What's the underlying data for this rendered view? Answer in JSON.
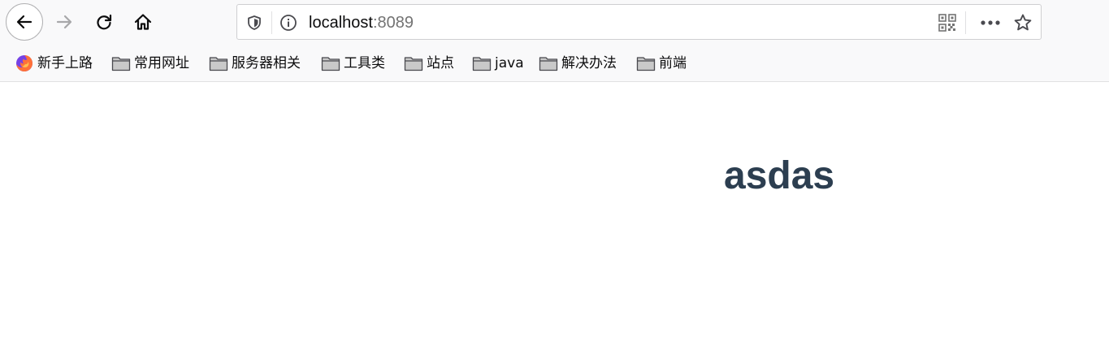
{
  "address_bar": {
    "host": "localhost",
    "port": ":8089"
  },
  "bookmarks": [
    {
      "label": "新手上路",
      "icon": "firefox-icon"
    },
    {
      "label": "常用网址",
      "icon": "folder-icon"
    },
    {
      "label": "服务器相关",
      "icon": "folder-icon"
    },
    {
      "label": "工具类",
      "icon": "folder-icon"
    },
    {
      "label": "站点",
      "icon": "folder-icon"
    },
    {
      "label": "java",
      "icon": "folder-icon"
    },
    {
      "label": "解决办法",
      "icon": "folder-icon"
    },
    {
      "label": "前端",
      "icon": "folder-icon"
    }
  ],
  "page": {
    "heading": "asdas"
  },
  "colors": {
    "heading": "#2c3e50",
    "toolbar_bg": "#f9f9fa",
    "port_text": "#737373"
  }
}
